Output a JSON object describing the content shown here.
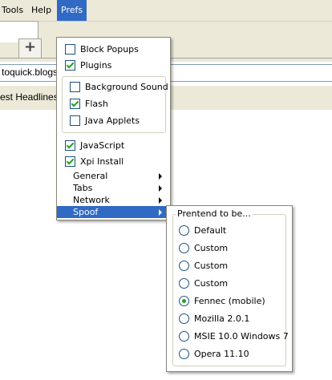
{
  "menubar": {
    "items": [
      {
        "label": "Tools"
      },
      {
        "label": "Help"
      },
      {
        "label": "Prefs"
      }
    ]
  },
  "tabs": {
    "new_tab_label": "+"
  },
  "urlbar": {
    "value": "toquick.blogsp"
  },
  "bookmarks": {
    "item_label": "est Headlines"
  },
  "prefs_menu": {
    "block_popups": {
      "label": "Block Popups",
      "checked": false
    },
    "plugins": {
      "label": "Plugins",
      "checked": true
    },
    "background_sound": {
      "label": "Background Sound",
      "checked": false
    },
    "flash": {
      "label": "Flash",
      "checked": true
    },
    "java_applets": {
      "label": "Java Applets",
      "checked": false
    },
    "javascript": {
      "label": "JavaScript",
      "checked": true
    },
    "xpi_install": {
      "label": "Xpi Install",
      "checked": true
    },
    "submenus": [
      {
        "label": "General"
      },
      {
        "label": "Tabs"
      },
      {
        "label": "Network"
      },
      {
        "label": "Spoof"
      }
    ]
  },
  "spoof_menu": {
    "legend": "Prentend to be...",
    "options": [
      {
        "label": "Default",
        "selected": false
      },
      {
        "label": "Custom",
        "selected": false
      },
      {
        "label": "Custom",
        "selected": false
      },
      {
        "label": "Custom",
        "selected": false
      },
      {
        "label": "Fennec (mobile)",
        "selected": true
      },
      {
        "label": "Mozilla 2.0.1",
        "selected": false
      },
      {
        "label": "MSIE 10.0 Windows 7",
        "selected": false
      },
      {
        "label": "Opera 11.10",
        "selected": false
      }
    ]
  },
  "colors": {
    "menu_highlight": "#316ac5",
    "chrome_background": "#ece9d8",
    "check_green": "#21a121"
  }
}
